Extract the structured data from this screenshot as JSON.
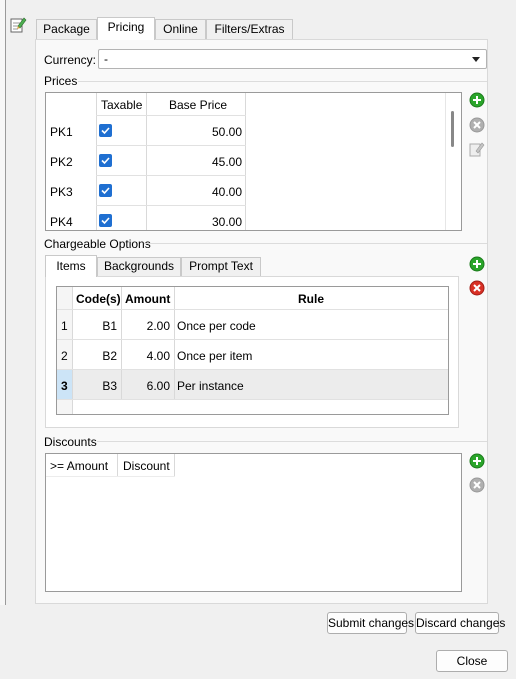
{
  "tabs": [
    "Package",
    "Pricing",
    "Online",
    "Filters/Extras"
  ],
  "currency": {
    "label": "Currency:",
    "value": "-"
  },
  "prices": {
    "heading": "Prices",
    "columns": [
      "",
      "Taxable",
      "Base Price"
    ],
    "rows": [
      {
        "name": "PK1",
        "taxable": true,
        "price": "50.00"
      },
      {
        "name": "PK2",
        "taxable": true,
        "price": "45.00"
      },
      {
        "name": "PK3",
        "taxable": true,
        "price": "40.00"
      },
      {
        "name": "PK4",
        "taxable": true,
        "price": "30.00"
      }
    ]
  },
  "chargeable": {
    "heading": "Chargeable Options",
    "tabs": [
      "Items",
      "Backgrounds",
      "Prompt Text"
    ],
    "columns": [
      "Code(s)",
      "Amount",
      "Rule"
    ],
    "rows": [
      {
        "num": "1",
        "code": "B1",
        "amount": "2.00",
        "rule": "Once per code"
      },
      {
        "num": "2",
        "code": "B2",
        "amount": "4.00",
        "rule": "Once per item"
      },
      {
        "num": "3",
        "code": "B3",
        "amount": "6.00",
        "rule": "Per instance"
      }
    ],
    "selected_row": "3"
  },
  "discounts": {
    "heading": "Discounts",
    "columns": [
      ">= Amount",
      "Discount"
    ]
  },
  "buttons": {
    "submit": "Submit changes",
    "discard": "Discard changes",
    "close": "Close"
  },
  "colors": {
    "add": "#2aa52a",
    "remove": "#d93025",
    "disabled": "#b0b0b0",
    "checkbox": "#1f6fd1",
    "selected_row": "#ececec",
    "selected_header": "#cce4f7"
  }
}
